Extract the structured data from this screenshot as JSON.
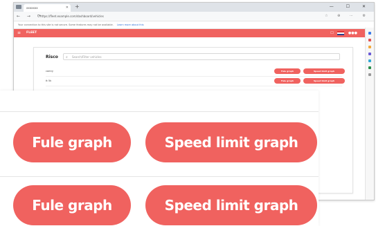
{
  "browser": {
    "tab_title": "xxxxxxx",
    "url": "https://fleet.example.com/dashboard/vehicles",
    "new_tab": "+",
    "window_controls": "— ☐ ✕",
    "nav_icons": "← → ⟳",
    "addr_icons": "☆ ⊕ ⋯ ⚙"
  },
  "infobar": {
    "text": "Your connection to this site is not secure. Some features may not be available.",
    "link": "Learn more about this"
  },
  "appbar": {
    "menu_icon": "menu-icon",
    "logo": "FLEET",
    "user": "● ● ▬ ●●●",
    "accent": "#f0625f"
  },
  "content": {
    "title": "Risco",
    "search_placeholder": "Search/Filter vehicles",
    "rows": [
      {
        "label": "camry",
        "btn1": "Fule graph",
        "btn2": "Speed limit graph"
      },
      {
        "label": "tt 5k",
        "btn1": "Fule graph",
        "btn2": "Speed limit graph"
      }
    ]
  },
  "zoom": {
    "row1": {
      "btn1": "Fule graph",
      "btn2": "Speed limit graph"
    },
    "row2": {
      "btn1": "Fule graph",
      "btn2": "Speed limit graph"
    }
  },
  "sidebar_colors": [
    "#3b7be8",
    "#e24f4f",
    "#f2a93b",
    "#2a8f4a",
    "#6a5ad6",
    "#2fa8d6",
    "#999999"
  ]
}
